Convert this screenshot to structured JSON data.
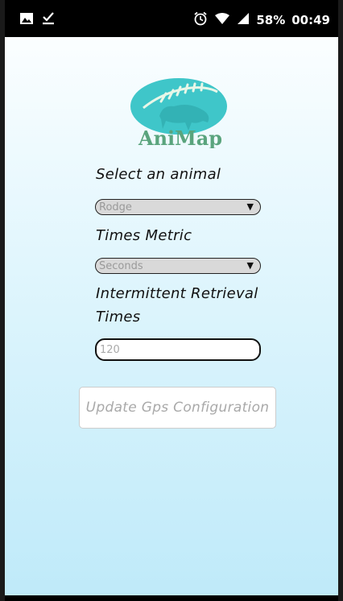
{
  "status_bar": {
    "battery_percent": "58%",
    "time": "00:49",
    "icons": [
      "image-icon",
      "download-done-icon",
      "alarm-icon",
      "wifi-icon",
      "signal-icon"
    ]
  },
  "app": {
    "logo_text": "AniMap"
  },
  "form": {
    "animal_label": "Select an animal",
    "animal_selected": "Rodge",
    "metric_label": "Times Metric",
    "metric_selected": "Seconds",
    "retrieval_label_line1": "Intermittent Retrieval",
    "retrieval_label_line2": "Times",
    "retrieval_value": "120",
    "update_button_label": "Update Gps Configuration"
  },
  "colors": {
    "background_top": "#fbfeff",
    "background_bottom": "#bfeaf9",
    "logo_teal": "#3fc6c9",
    "logo_text": "#5aa47d"
  }
}
